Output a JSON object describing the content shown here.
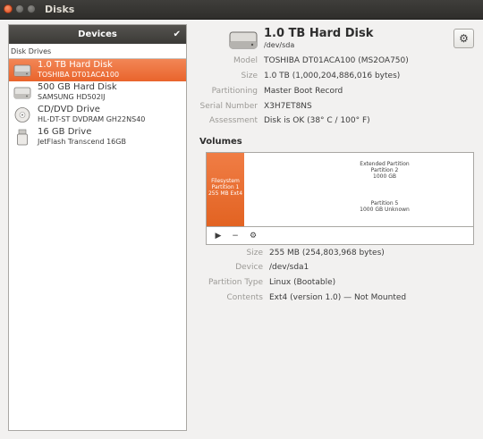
{
  "window": {
    "title": "Disks"
  },
  "sidebar": {
    "header": "Devices",
    "check": "✔",
    "section": "Disk Drives",
    "drives": [
      {
        "name": "1.0 TB Hard Disk",
        "model": "TOSHIBA DT01ACA100",
        "icon": "hard-disk-icon",
        "selected": true
      },
      {
        "name": "500 GB Hard Disk",
        "model": "SAMSUNG HD502IJ",
        "icon": "hard-disk-icon",
        "selected": false
      },
      {
        "name": "CD/DVD Drive",
        "model": "HL-DT-ST DVDRAM GH22NS40",
        "icon": "optical-drive-icon",
        "selected": false
      },
      {
        "name": "16 GB Drive",
        "model": "JetFlash Transcend 16GB",
        "icon": "usb-drive-icon",
        "selected": false
      }
    ]
  },
  "disk": {
    "title": "1.0 TB Hard Disk",
    "device": "/dev/sda",
    "model_label": "Model",
    "model": "TOSHIBA DT01ACA100 (MS2OA750)",
    "size_label": "Size",
    "size": "1.0 TB (1,000,204,886,016 bytes)",
    "partitioning_label": "Partitioning",
    "partitioning": "Master Boot Record",
    "serial_label": "Serial Number",
    "serial": "X3H7ET8NS",
    "assessment_label": "Assessment",
    "assessment": "Disk is OK (38° C / 100° F)"
  },
  "volumes": {
    "title": "Volumes",
    "partition1": [
      "Filesystem",
      "Partition 1",
      "255 MB Ext4"
    ],
    "extended": [
      "Extended Partition",
      "Partition 2",
      "1000 GB"
    ],
    "partition5": [
      "Partition 5",
      "1000 GB Unknown"
    ],
    "toolbar": {
      "play": "▶",
      "minus": "−",
      "settings": "⚙"
    },
    "selected": {
      "size_label": "Size",
      "size": "255 MB (254,803,968 bytes)",
      "device_label": "Device",
      "device": "/dev/sda1",
      "ptype_label": "Partition Type",
      "ptype": "Linux (Bootable)",
      "contents_label": "Contents",
      "contents": "Ext4 (version 1.0) — Not Mounted"
    }
  },
  "colors": {
    "accent": "#e9642c",
    "titlebar": "#3c3b37"
  }
}
